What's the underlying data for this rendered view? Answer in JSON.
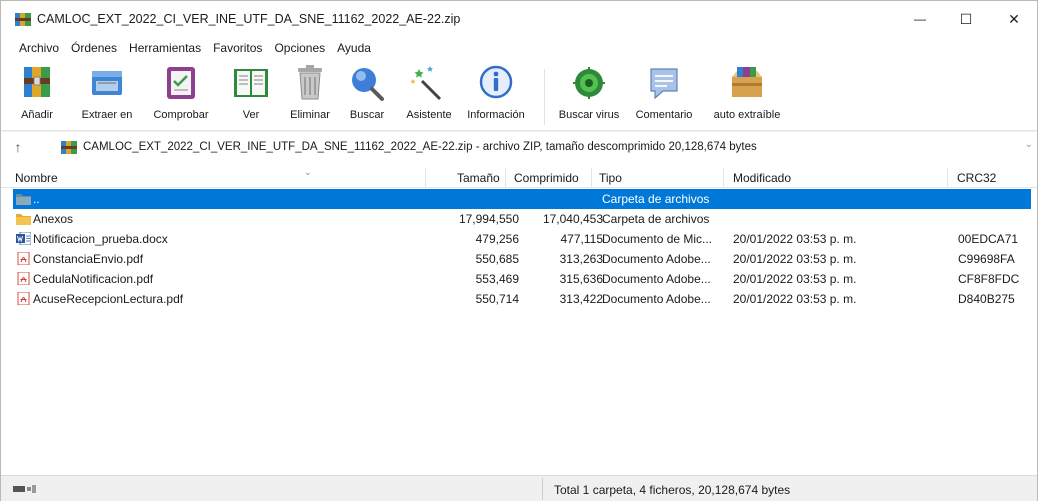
{
  "window": {
    "title": "CAMLOC_EXT_2022_CI_VER_INE_UTF_DA_SNE_11162_2022_AE-22.zip",
    "minimize_glyph": "—",
    "maximize_glyph": "☐",
    "close_glyph": "✕"
  },
  "menu": [
    "Archivo",
    "Órdenes",
    "Herramientas",
    "Favoritos",
    "Opciones",
    "Ayuda"
  ],
  "toolbar": {
    "buttons": [
      {
        "label": "Añadir",
        "icon": "add-archive-icon"
      },
      {
        "label": "Extraer en",
        "icon": "extract-folder-icon"
      },
      {
        "label": "Comprobar",
        "icon": "test-checklist-icon"
      },
      {
        "label": "Ver",
        "icon": "view-book-icon"
      },
      {
        "label": "Eliminar",
        "icon": "trash-icon"
      },
      {
        "label": "Buscar",
        "icon": "magnifier-icon"
      },
      {
        "label": "Asistente",
        "icon": "wizard-wand-icon"
      },
      {
        "label": "Información",
        "icon": "info-icon"
      },
      {
        "label": "Buscar virus",
        "icon": "virus-scan-icon"
      },
      {
        "label": "Comentario",
        "icon": "comment-icon"
      },
      {
        "label": "auto extraíble",
        "icon": "sfx-box-icon"
      }
    ]
  },
  "address": {
    "up_glyph": "↑",
    "text": "CAMLOC_EXT_2022_CI_VER_INE_UTF_DA_SNE_11162_2022_AE-22.zip - archivo ZIP, tamaño descomprimido 20,128,674 bytes",
    "dropdown_glyph": "⌄"
  },
  "columns": {
    "name": "Nombre",
    "size": "Tamaño",
    "packed": "Comprimido",
    "type": "Tipo",
    "modified": "Modificado",
    "crc": "CRC32",
    "sort_glyph": "⌄"
  },
  "rows": [
    {
      "name": "..",
      "size": "",
      "packed": "",
      "type": "Carpeta de archivos",
      "modified": "",
      "crc": "",
      "icon": "parent-folder-icon",
      "selected": true
    },
    {
      "name": "Anexos",
      "size": "17,994,550",
      "packed": "17,040,453",
      "type": "Carpeta de archivos",
      "modified": "",
      "crc": "",
      "icon": "folder-icon",
      "selected": false
    },
    {
      "name": "Notificacion_prueba.docx",
      "size": "479,256",
      "packed": "477,115",
      "type": "Documento de Mic...",
      "modified": "20/01/2022 03:53 p. m.",
      "crc": "00EDCA71",
      "icon": "word-doc-icon",
      "selected": false
    },
    {
      "name": "ConstanciaEnvio.pdf",
      "size": "550,685",
      "packed": "313,263",
      "type": "Documento Adobe...",
      "modified": "20/01/2022 03:53 p. m.",
      "crc": "C99698FA",
      "icon": "pdf-icon",
      "selected": false
    },
    {
      "name": "CedulaNotificacion.pdf",
      "size": "553,469",
      "packed": "315,636",
      "type": "Documento Adobe...",
      "modified": "20/01/2022 03:53 p. m.",
      "crc": "CF8F8FDC",
      "icon": "pdf-icon",
      "selected": false
    },
    {
      "name": "AcuseRecepcionLectura.pdf",
      "size": "550,714",
      "packed": "313,422",
      "type": "Documento Adobe...",
      "modified": "20/01/2022 03:53 p. m.",
      "crc": "D840B275",
      "icon": "pdf-icon",
      "selected": false
    }
  ],
  "status": {
    "text": "Total 1 carpeta, 4 ficheros, 20,128,674 bytes",
    "left_icon": "drive-status-icon"
  },
  "colors": {
    "selection": "#0078d7",
    "folder": "#f4c44e",
    "pdf_red": "#d33a2c",
    "word_blue": "#2b579a"
  }
}
